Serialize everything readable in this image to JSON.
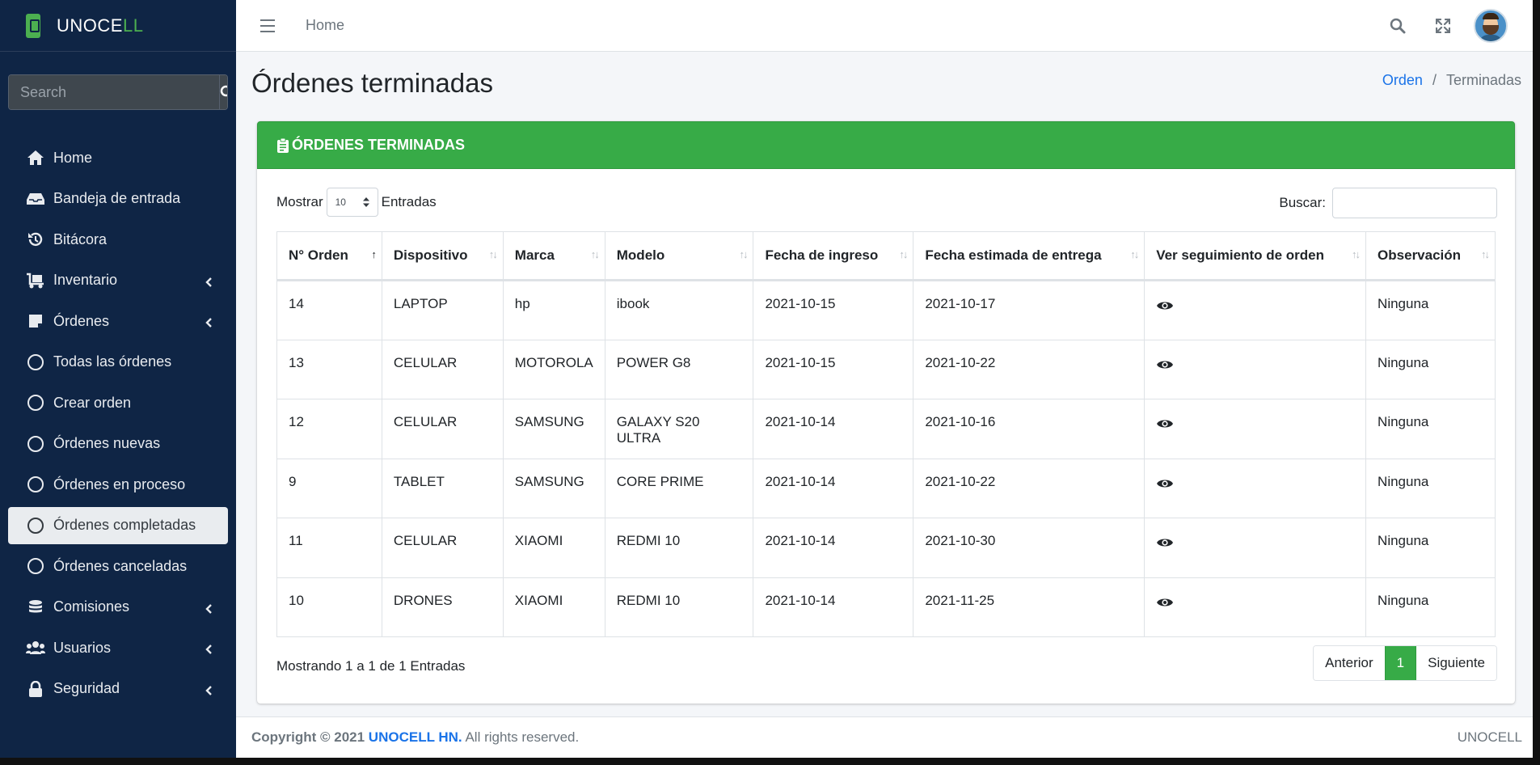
{
  "app": {
    "brand_main": "UNOCE",
    "brand_accent": "LL",
    "accent_color": "#37ab47",
    "sidebar_color": "#0f2545"
  },
  "sidebar": {
    "search_placeholder": "Search",
    "items": [
      {
        "label": "Home",
        "icon": "home-icon",
        "has_caret": false
      },
      {
        "label": "Bandeja de entrada",
        "icon": "inbox-icon",
        "has_caret": false
      },
      {
        "label": "Bitácora",
        "icon": "history-icon",
        "has_caret": false
      },
      {
        "label": "Inventario",
        "icon": "dolly-icon",
        "has_caret": true
      },
      {
        "label": "Órdenes",
        "icon": "note-icon",
        "has_caret": true
      },
      {
        "label": "Todas las órdenes",
        "icon": "circle-icon",
        "has_caret": false
      },
      {
        "label": "Crear orden",
        "icon": "circle-icon",
        "has_caret": false
      },
      {
        "label": "Órdenes nuevas",
        "icon": "circle-icon",
        "has_caret": false
      },
      {
        "label": "Órdenes en proceso",
        "icon": "circle-icon",
        "has_caret": false
      },
      {
        "label": "Órdenes completadas",
        "icon": "circle-icon",
        "has_caret": false,
        "active": true
      },
      {
        "label": "Órdenes canceladas",
        "icon": "circle-icon",
        "has_caret": false
      },
      {
        "label": "Comisiones",
        "icon": "coins-icon",
        "has_caret": true
      },
      {
        "label": "Usuarios",
        "icon": "users-icon",
        "has_caret": true
      },
      {
        "label": "Seguridad",
        "icon": "lock-icon",
        "has_caret": true
      }
    ]
  },
  "topbar": {
    "home_link": "Home"
  },
  "page": {
    "title": "Órdenes terminadas",
    "breadcrumb": {
      "link": "Orden",
      "separator": "/",
      "current": "Terminadas"
    }
  },
  "card": {
    "header": "ÓRDENES TERMINADAS",
    "show_label": "Mostrar",
    "show_value": "10",
    "entries_label": "Entradas",
    "search_label": "Buscar:",
    "search_value": "",
    "columns": [
      "N° Orden",
      "Dispositivo",
      "Marca",
      "Modelo",
      "Fecha de ingreso",
      "Fecha estimada de entrega",
      "Ver seguimiento de orden",
      "Observación"
    ],
    "rows": [
      [
        "14",
        "LAPTOP",
        "hp",
        "ibook",
        "2021-10-15",
        "2021-10-17",
        "Ninguna"
      ],
      [
        "13",
        "CELULAR",
        "MOTOROLA",
        "POWER G8",
        "2021-10-15",
        "2021-10-22",
        "Ninguna"
      ],
      [
        "12",
        "CELULAR",
        "SAMSUNG",
        "GALAXY S20 ULTRA",
        "2021-10-14",
        "2021-10-16",
        "Ninguna"
      ],
      [
        "9",
        "TABLET",
        "SAMSUNG",
        "CORE PRIME",
        "2021-10-14",
        "2021-10-22",
        "Ninguna"
      ],
      [
        "11",
        "CELULAR",
        "XIAOMI",
        "REDMI 10",
        "2021-10-14",
        "2021-10-30",
        "Ninguna"
      ],
      [
        "10",
        "DRONES",
        "XIAOMI",
        "REDMI 10",
        "2021-10-14",
        "2021-11-25",
        "Ninguna"
      ]
    ],
    "info": "Mostrando 1 a 1 de 1 Entradas",
    "pager": {
      "prev": "Anterior",
      "page": "1",
      "next": "Siguiente"
    }
  },
  "footer": {
    "copyright": "Copyright © 2021",
    "brand": "UNOCELL HN.",
    "rights": "All rights reserved.",
    "right_text": "UNOCELL"
  }
}
